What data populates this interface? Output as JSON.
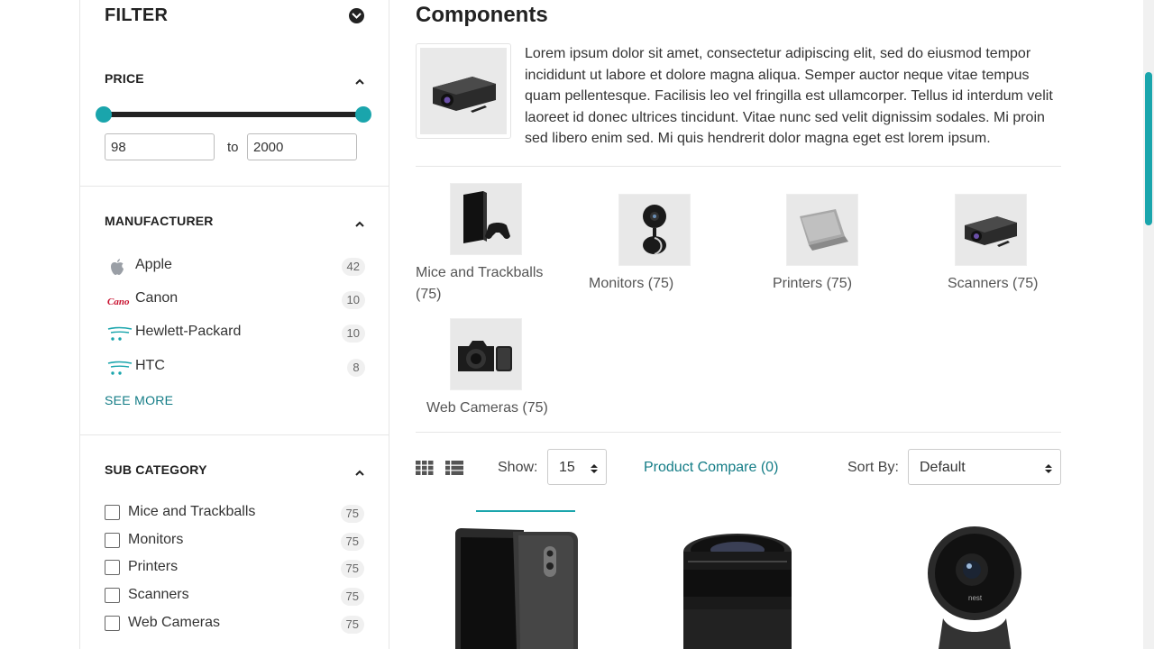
{
  "filter": {
    "title": "FILTER",
    "price": {
      "title": "PRICE",
      "min_value": "98",
      "max_value": "2000",
      "to_label": "to"
    },
    "manufacturer": {
      "title": "MANUFACTURER",
      "items": [
        {
          "name": "Apple",
          "count": "42",
          "icon": "apple-logo-icon"
        },
        {
          "name": "Canon",
          "count": "10",
          "icon": "canon-logo-icon"
        },
        {
          "name": "Hewlett-Packard",
          "count": "10",
          "icon": "cart-logo-icon"
        },
        {
          "name": "HTC",
          "count": "8",
          "icon": "cart-logo-icon"
        }
      ],
      "see_more": "SEE MORE"
    },
    "sub_category": {
      "title": "SUB CATEGORY",
      "items": [
        {
          "name": "Mice and Trackballs",
          "count": "75"
        },
        {
          "name": "Monitors",
          "count": "75"
        },
        {
          "name": "Printers",
          "count": "75"
        },
        {
          "name": "Scanners",
          "count": "75"
        },
        {
          "name": "Web Cameras",
          "count": "75"
        }
      ]
    }
  },
  "main": {
    "title": "Components",
    "description": "Lorem ipsum dolor sit amet, consectetur adipiscing elit, sed do eiusmod tempor incididunt ut labore et dolore magna aliqua. Semper auctor neque vitae tempus quam pellentesque. Facilisis leo vel fringilla est ullamcorper. Tellus id interdum velit laoreet id donec ultrices tincidunt. Vitae nunc sed velit dignissim sodales. Mi proin sed libero enim sed. Mi quis hendrerit dolor magna eget est lorem ipsum.",
    "categories": [
      {
        "label": "Mice and Trackballs (75)",
        "image": "game-console-image"
      },
      {
        "label": "Monitors (75)",
        "image": "security-camera-image"
      },
      {
        "label": "Printers (75)",
        "image": "laptop-image"
      },
      {
        "label": "Scanners (75)",
        "image": "projector-image"
      },
      {
        "label": "Web Cameras (75)",
        "image": "dslr-camera-image"
      }
    ],
    "toolbar": {
      "show_label": "Show:",
      "show_value": "15",
      "compare_link": "Product Compare (0)",
      "sort_label": "Sort By:",
      "sort_value": "Default"
    },
    "products": [
      {
        "image": "smartphone-image"
      },
      {
        "image": "camera-lens-image"
      },
      {
        "image": "home-camera-image"
      }
    ]
  },
  "colors": {
    "accent": "#1aa5ac",
    "link": "#137c86",
    "text": "#333333",
    "border": "#e6e6e6"
  }
}
